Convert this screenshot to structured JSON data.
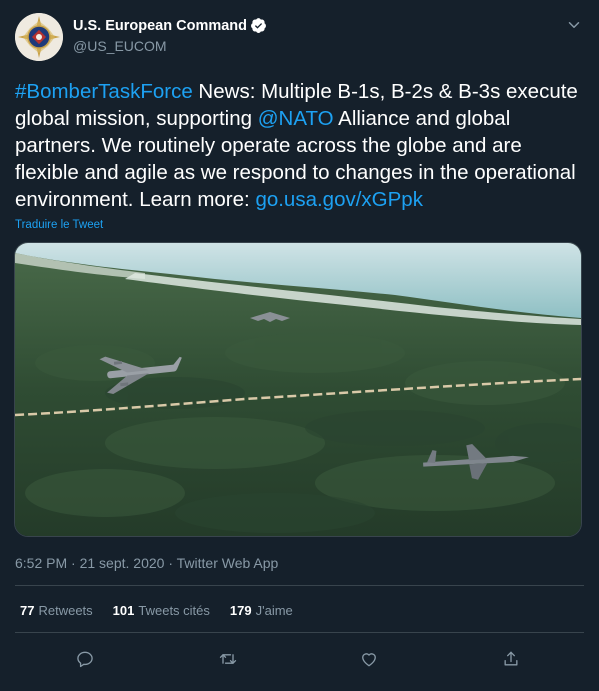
{
  "header": {
    "display_name": "U.S. European Command",
    "handle": "@US_EUCOM"
  },
  "tweet": {
    "hashtag": "#BomberTaskForce",
    "text_1": " News: Multiple B-1s, B-2s & B-3s execute global mission, supporting ",
    "mention": "@NATO",
    "text_2": " Alliance and global partners. We routinely operate across the globe and are flexible and agile as we respond to changes in the operational environment. Learn more: ",
    "url": "go.usa.gov/xGPpk",
    "translate_label": "Traduire le Tweet"
  },
  "meta": {
    "time": "6:52 PM",
    "date": "21 sept. 2020",
    "separator": "·",
    "source": "Twitter Web App"
  },
  "stats": {
    "retweets_count": "77",
    "retweets_label": "Retweets",
    "quotes_count": "101",
    "quotes_label": "Tweets cités",
    "likes_count": "179",
    "likes_label": "J'aime"
  },
  "icons": {
    "verified": "verified-badge-icon",
    "caret": "chevron-down-icon",
    "reply": "reply-icon",
    "retweet": "retweet-icon",
    "like": "heart-icon",
    "share": "share-icon"
  },
  "colors": {
    "background": "#15202b",
    "accent": "#1da1f2",
    "secondary_text": "#8899a6",
    "divider": "#38444d"
  }
}
